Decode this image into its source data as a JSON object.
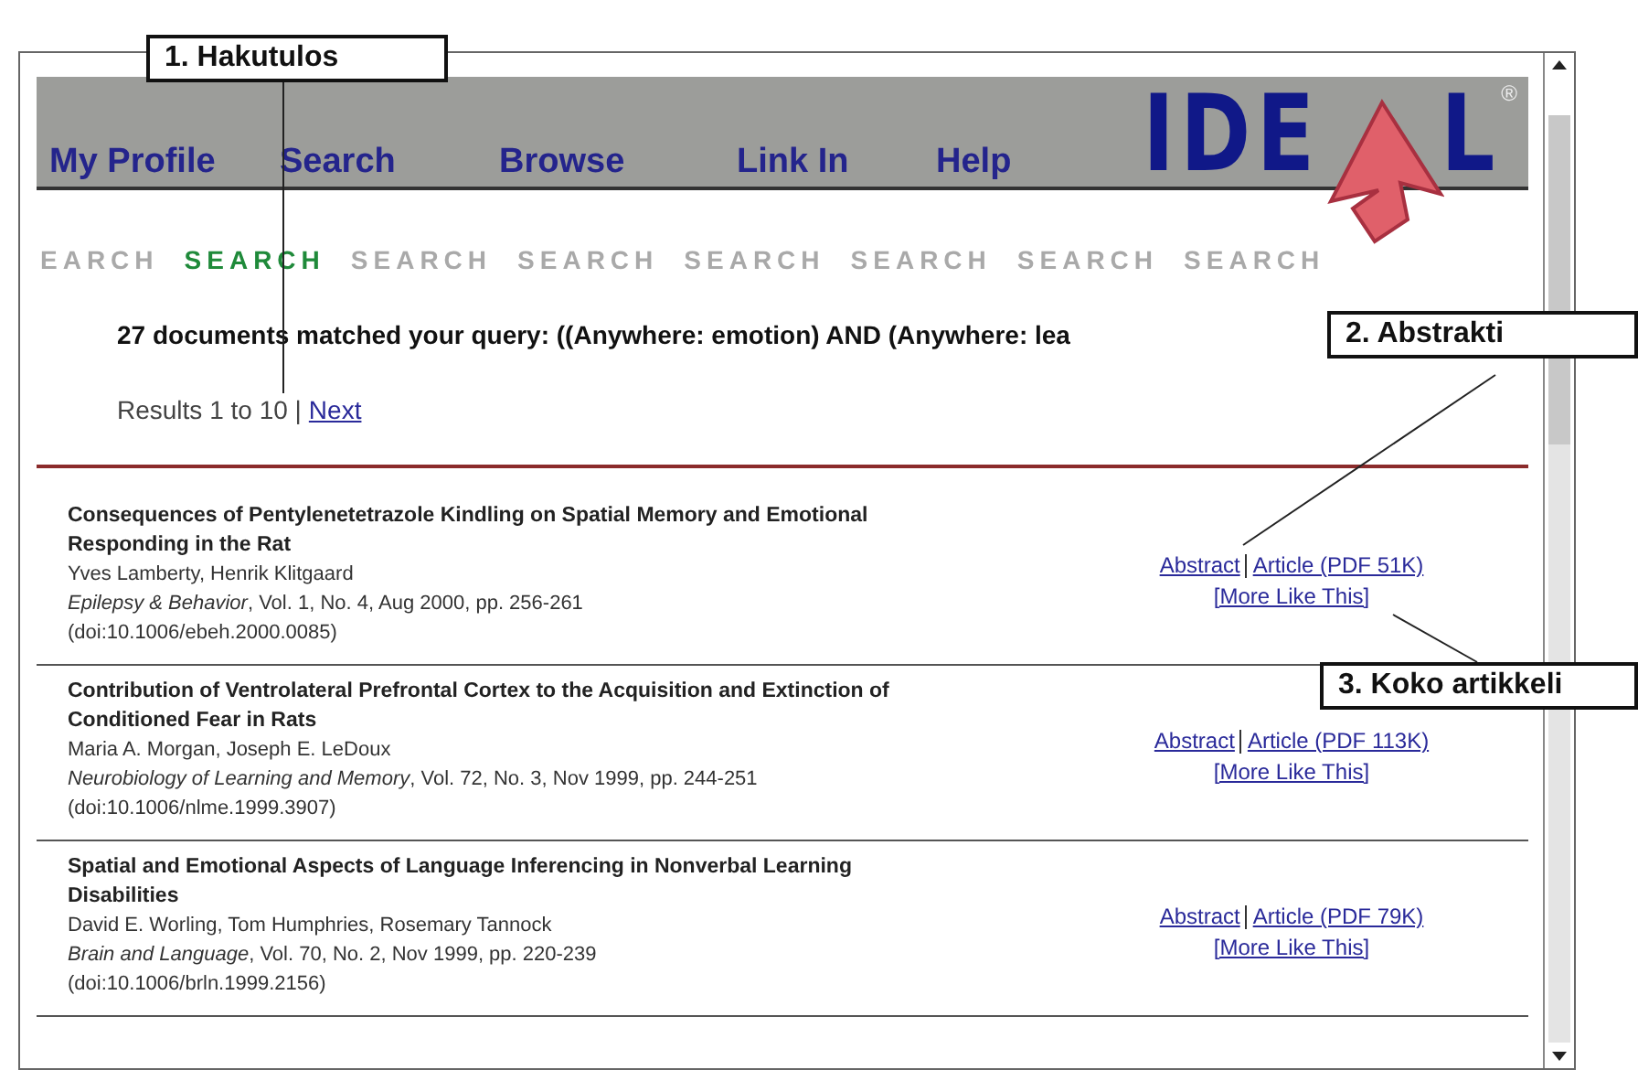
{
  "nav": {
    "links": [
      {
        "label": "My Profile"
      },
      {
        "label": "Search"
      },
      {
        "label": "Browse"
      },
      {
        "label": "Link In"
      },
      {
        "label": "Help"
      }
    ],
    "logo": {
      "left": "IDE",
      "right": "L",
      "mark": "®"
    }
  },
  "search_banner": [
    {
      "text": "EARCH",
      "selected": false
    },
    {
      "text": "SEARCH",
      "selected": true
    },
    {
      "text": "SEARCH",
      "selected": false
    },
    {
      "text": "SEARCH",
      "selected": false
    },
    {
      "text": "SEARCH",
      "selected": false
    },
    {
      "text": "SEARCH",
      "selected": false
    },
    {
      "text": "SEARCH",
      "selected": false
    },
    {
      "text": "SEARCH",
      "selected": false
    }
  ],
  "query_summary": "27 documents matched your query: ((Anywhere: emotion) AND (Anywhere: lea",
  "results_range": {
    "text": "Results 1 to 10 |",
    "next": "Next"
  },
  "results": [
    {
      "title": "Consequences of Pentylenetetrazole Kindling on Spatial Memory and Emotional Responding in the Rat",
      "authors": "Yves Lamberty, Henrik Klitgaard",
      "source": "*Epilepsy & Behavior*, Vol. 1, No. 4, Aug 2000, pp. 256-261",
      "doi": "(doi:10.1006/ebeh.2000.0085)",
      "abstract": "Abstract",
      "article": "Article (PDF 51K)",
      "more": "[More Like This]"
    },
    {
      "title": "Contribution of Ventrolateral Prefrontal Cortex to the Acquisition and Extinction of Conditioned Fear in Rats",
      "authors": "Maria A. Morgan, Joseph E. LeDoux",
      "source": "*Neurobiology of Learning and Memory*, Vol. 72, No. 3, Nov 1999, pp. 244-251",
      "doi": "(doi:10.1006/nlme.1999.3907)",
      "abstract": "Abstract",
      "article": "Article (PDF 113K)",
      "more": "[More Like This]"
    },
    {
      "title": "Spatial and Emotional Aspects of Language Inferencing in Nonverbal Learning Disabilities",
      "authors": "David E. Worling, Tom Humphries, Rosemary Tannock",
      "source": "*Brain and Language*, Vol. 70, No. 2, Nov 1999, pp. 220-239",
      "doi": "(doi:10.1006/brln.1999.2156)",
      "abstract": "Abstract",
      "article": "Article (PDF 79K)",
      "more": "[More Like This]"
    }
  ],
  "callouts": [
    "1. Hakutulos",
    "2. Abstrakti",
    "3. Koko artikkeli"
  ]
}
